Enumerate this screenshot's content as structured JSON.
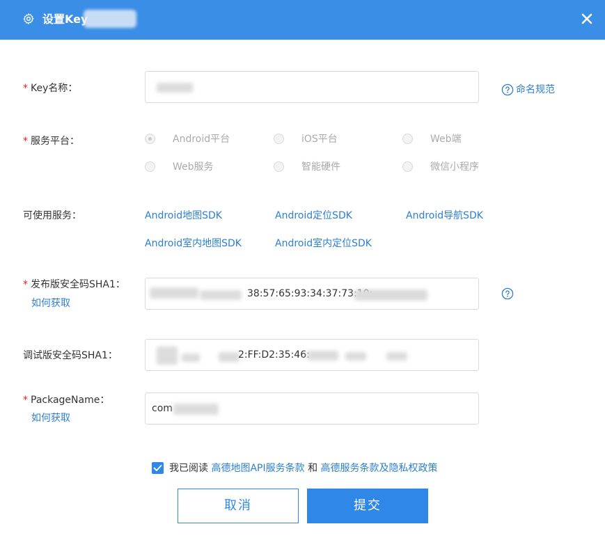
{
  "header": {
    "title": "设置Key",
    "icon": "gear-icon",
    "close_icon": "close-icon",
    "background": "#3a8ee6"
  },
  "form": {
    "key_name": {
      "label": "Key名称：",
      "required_mark": "*",
      "value": "",
      "help_link": "命名规范"
    },
    "platform": {
      "label": "服务平台：",
      "required_mark": "*",
      "options": [
        "Android平台",
        "iOS平台",
        "Web端",
        "Web服务",
        "智能硬件",
        "微信小程序"
      ],
      "selected": "Android平台"
    },
    "services": {
      "label": "可使用服务：",
      "items": [
        "Android地图SDK",
        "Android定位SDK",
        "Android导航SDK",
        "Android室内地图SDK",
        "Android室内定位SDK"
      ]
    },
    "release_sha1": {
      "label": "发布版安全码SHA1：",
      "required_mark": "*",
      "how_to_link": "如何获取",
      "value": "38:57:65:93:34:37:73:10:"
    },
    "debug_sha1": {
      "label": "调试版安全码SHA1：",
      "value": "2:FF:D2:35:46:"
    },
    "package_name": {
      "label": "PackageName：",
      "required_mark": "*",
      "how_to_link": "如何获取",
      "value": "com"
    },
    "agreement": {
      "checked": true,
      "prefix": "我已阅读",
      "link1": "高德地图API服务条款",
      "conj": "和",
      "link2": "高德服务条款及隐私权政策"
    }
  },
  "buttons": {
    "cancel": "取消",
    "submit": "提交"
  },
  "colors": {
    "accent": "#2f87e8",
    "required": "#e02020",
    "link": "#2d7fd0"
  }
}
